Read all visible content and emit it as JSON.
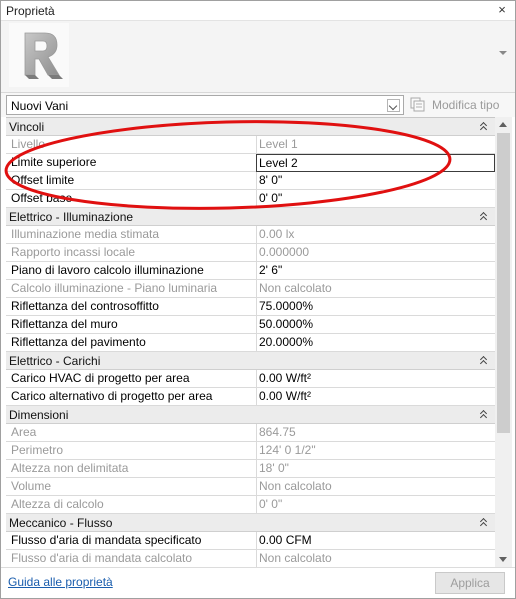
{
  "panel": {
    "title": "Proprietà",
    "close_glyph": "×"
  },
  "type_selector": {
    "value": "Nuovi Vani",
    "edit_type_label": "Modifica tipo"
  },
  "groups": [
    {
      "name": "Vincoli",
      "rows": [
        {
          "label": "Livello",
          "value": "Level 1",
          "readonly": true
        },
        {
          "label": "Limite superiore",
          "value": "Level 2",
          "readonly": false,
          "active": true
        },
        {
          "label": "Offset limite",
          "value": "8'  0\"",
          "readonly": false
        },
        {
          "label": "Offset base",
          "value": "0'  0\"",
          "readonly": false
        }
      ]
    },
    {
      "name": "Elettrico - Illuminazione",
      "rows": [
        {
          "label": "Illuminazione media stimata",
          "value": "0.00 lx",
          "readonly": true
        },
        {
          "label": "Rapporto incassi locale",
          "value": "0.000000",
          "readonly": true
        },
        {
          "label": "Piano di lavoro calcolo illuminazione",
          "value": "2'  6\"",
          "readonly": false
        },
        {
          "label": "Calcolo illuminazione - Piano luminaria",
          "value": "Non calcolato",
          "readonly": true
        },
        {
          "label": "Riflettanza del controsoffitto",
          "value": "75.0000%",
          "readonly": false
        },
        {
          "label": "Riflettanza del muro",
          "value": "50.0000%",
          "readonly": false
        },
        {
          "label": "Riflettanza del pavimento",
          "value": "20.0000%",
          "readonly": false
        }
      ]
    },
    {
      "name": "Elettrico - Carichi",
      "rows": [
        {
          "label": "Carico HVAC di progetto per area",
          "value": "0.00 W/ft²",
          "readonly": false
        },
        {
          "label": "Carico alternativo di progetto per area",
          "value": "0.00 W/ft²",
          "readonly": false
        }
      ]
    },
    {
      "name": "Dimensioni",
      "rows": [
        {
          "label": "Area",
          "value": "864.75",
          "readonly": true
        },
        {
          "label": "Perimetro",
          "value": "124'  0 1/2\"",
          "readonly": true
        },
        {
          "label": "Altezza non delimitata",
          "value": "18'  0\"",
          "readonly": true
        },
        {
          "label": "Volume",
          "value": "Non calcolato",
          "readonly": true
        },
        {
          "label": "Altezza di calcolo",
          "value": "0'  0\"",
          "readonly": true
        }
      ]
    },
    {
      "name": "Meccanico - Flusso",
      "rows": [
        {
          "label": "Flusso d'aria di mandata specificato",
          "value": "0.00 CFM",
          "readonly": false
        },
        {
          "label": "Flusso d'aria di mandata calcolato",
          "value": "Non calcolato",
          "readonly": true
        }
      ]
    }
  ],
  "footer": {
    "help_link": "Guida alle proprietà",
    "apply_label": "Applica"
  },
  "icons": {
    "revit": "revit-logo-icon",
    "edit_type": "edit-type-icon",
    "group_toggle": "collapse-icon"
  },
  "colors": {
    "highlight": "#e01010",
    "link": "#1a5dad"
  }
}
